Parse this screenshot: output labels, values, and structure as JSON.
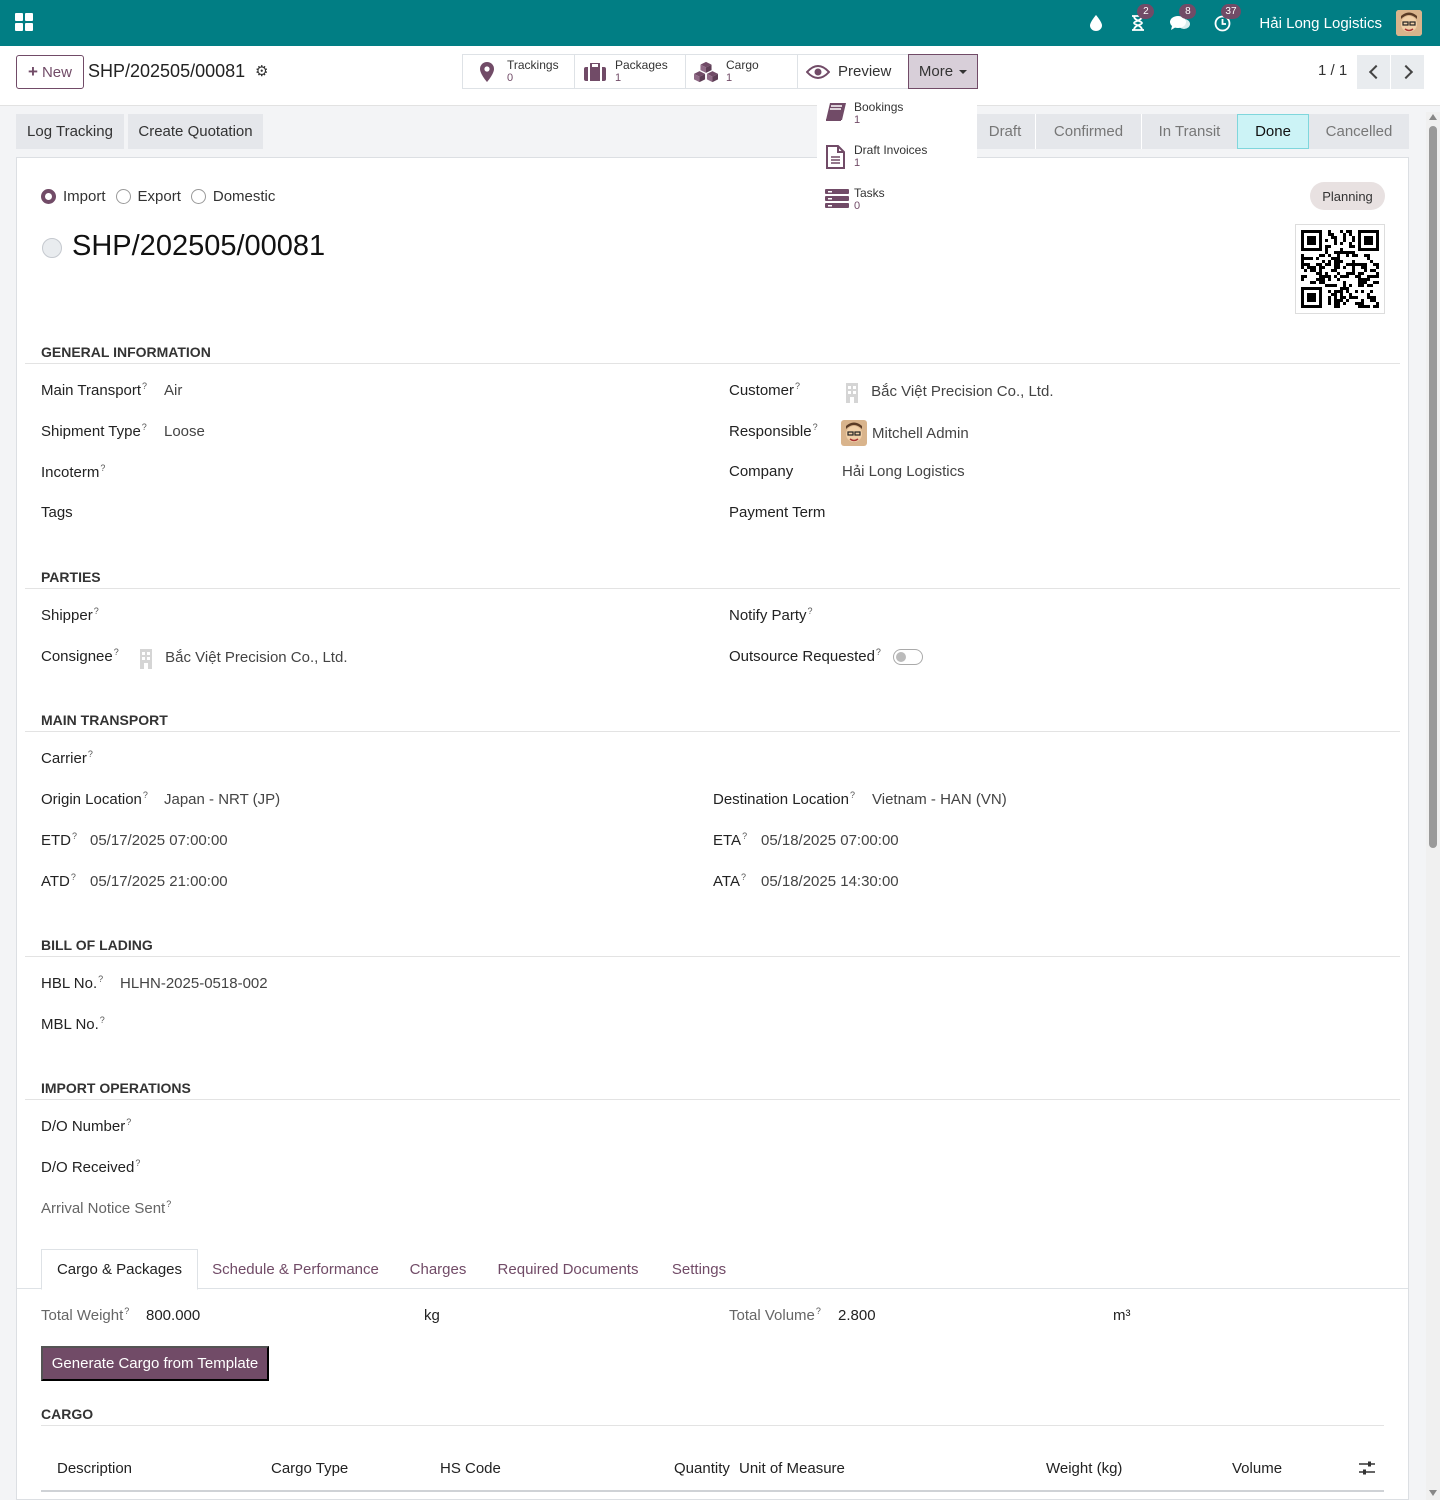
{
  "navbar": {
    "company": "Hải Long Logistics",
    "activity_count": "2",
    "messages_count": "8",
    "updates_count": "37",
    "accent": "#017e84"
  },
  "control": {
    "new_label": "New",
    "breadcrumb": "SHP/202505/00081",
    "pager": "1 / 1"
  },
  "smart_buttons": {
    "trackings": {
      "label": "Trackings",
      "value": "0"
    },
    "packages": {
      "label": "Packages",
      "value": "1"
    },
    "cargo": {
      "label": "Cargo",
      "value": "1"
    },
    "preview": {
      "label": "Preview"
    },
    "more": {
      "label": "More"
    }
  },
  "more_menu": [
    {
      "label": "Bookings",
      "value": "1",
      "icon": "book-icon"
    },
    {
      "label": "Draft Invoices",
      "value": "1",
      "icon": "document-icon"
    },
    {
      "label": "Tasks",
      "value": "0",
      "icon": "tasks-icon"
    }
  ],
  "actions": {
    "log_tracking": "Log Tracking",
    "create_quotation": "Create Quotation"
  },
  "statusbar": {
    "stages": [
      "Draft",
      "Confirmed",
      "In Transit",
      "Done",
      "Cancelled"
    ],
    "current": "Done"
  },
  "form": {
    "direction_options": [
      "Import",
      "Export",
      "Domestic"
    ],
    "direction_selected": "Import",
    "title": "SHP/202505/00081",
    "badge": "Planning",
    "general": {
      "section": "GENERAL INFORMATION",
      "main_transport_label": "Main Transport",
      "main_transport": "Air",
      "shipment_type_label": "Shipment Type",
      "shipment_type": "Loose",
      "incoterm_label": "Incoterm",
      "tags_label": "Tags",
      "customer_label": "Customer",
      "customer": "Bắc Việt Precision Co., Ltd.",
      "responsible_label": "Responsible",
      "responsible": "Mitchell Admin",
      "company_label": "Company",
      "company": "Hải Long Logistics",
      "payment_term_label": "Payment Term"
    },
    "parties": {
      "section": "PARTIES",
      "shipper_label": "Shipper",
      "consignee_label": "Consignee",
      "consignee": "Bắc Việt Precision Co., Ltd.",
      "notify_label": "Notify Party",
      "outsource_label": "Outsource Requested"
    },
    "transport": {
      "section": "MAIN TRANSPORT",
      "carrier_label": "Carrier",
      "origin_label": "Origin Location",
      "origin": "Japan - NRT (JP)",
      "dest_label": "Destination Location",
      "dest": "Vietnam - HAN (VN)",
      "etd_label": "ETD",
      "etd": "05/17/2025 07:00:00",
      "eta_label": "ETA",
      "eta": "05/18/2025 07:00:00",
      "atd_label": "ATD",
      "atd": "05/17/2025 21:00:00",
      "ata_label": "ATA",
      "ata": "05/18/2025 14:30:00"
    },
    "bill": {
      "section": "BILL OF LADING",
      "hbl_label": "HBL No.",
      "hbl": "HLHN-2025-0518-002",
      "mbl_label": "MBL No."
    },
    "import_ops": {
      "section": "IMPORT OPERATIONS",
      "do_number_label": "D/O Number",
      "do_received_label": "D/O Received",
      "arrival_label": "Arrival Notice Sent"
    }
  },
  "tabs": [
    "Cargo & Packages",
    "Schedule & Performance",
    "Charges",
    "Required Documents",
    "Settings"
  ],
  "cargo_tab": {
    "total_weight_label": "Total Weight",
    "total_weight": "800.000",
    "weight_unit": "kg",
    "total_volume_label": "Total Volume",
    "total_volume": "2.800",
    "volume_unit": "m³",
    "generate_btn": "Generate Cargo from Template",
    "cargo_section": "CARGO",
    "columns": [
      "Description",
      "Cargo Type",
      "HS Code",
      "Quantity",
      "Unit of Measure",
      "Weight (kg)",
      "Volume"
    ]
  }
}
